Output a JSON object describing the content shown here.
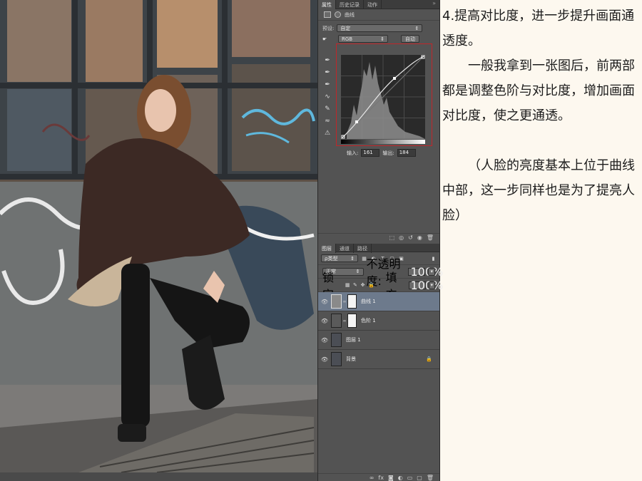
{
  "panel": {
    "tabs": [
      "属性",
      "历史记录",
      "动作"
    ],
    "tab_close": "»",
    "adjustment_name": "曲线",
    "preset_label": "预设:",
    "preset_value": "自定",
    "channel_value": "RGB",
    "auto_button": "自动",
    "input_label": "输入:",
    "input_value": "161",
    "output_label": "输出:",
    "output_value": "184"
  },
  "layers_panel": {
    "tabs": [
      "图层",
      "通道",
      "路径"
    ],
    "filter_kind": "ρ类型",
    "blend_mode": "正常",
    "opacity_label": "不透明度:",
    "opacity_value": "100%",
    "lock_label": "锁定:",
    "fill_label": "填充:",
    "fill_value": "100%",
    "layers": [
      {
        "name": "曲线 1",
        "selected": true
      },
      {
        "name": "色阶 1",
        "selected": false
      },
      {
        "name": "图层 1",
        "selected": false
      },
      {
        "name": "背景",
        "selected": false
      }
    ]
  },
  "article": {
    "heading": "4.提高对比度，进一步提升画面通透度。",
    "paragraph1": "一般我拿到一张图后，前两部都是调整色阶与对比度，增加画面对比度，使之更通透。",
    "paragraph2": "（人脸的亮度基本上位于曲线中部，这一步同样也是为了提亮人脸）"
  },
  "colors": {
    "panel_bg": "#535353",
    "selected_layer": "#6d7a8c",
    "highlight_border": "#c0262a",
    "page_bg": "#fdf8ef"
  }
}
